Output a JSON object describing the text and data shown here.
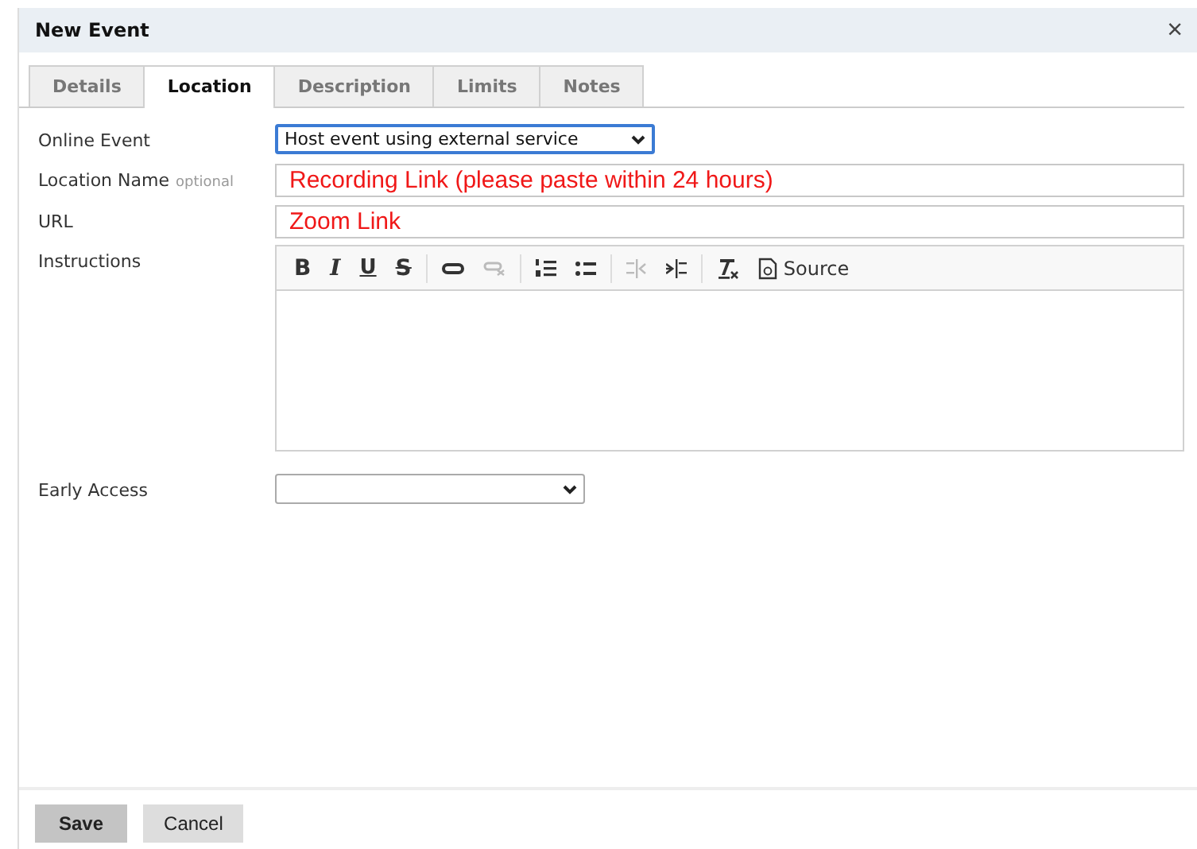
{
  "window": {
    "title": "New Event",
    "close": "×"
  },
  "tabs": [
    {
      "label": "Details",
      "selected": false
    },
    {
      "label": "Location",
      "selected": true
    },
    {
      "label": "Description",
      "selected": false
    },
    {
      "label": "Limits",
      "selected": false
    },
    {
      "label": "Notes",
      "selected": false
    }
  ],
  "fields": [
    {
      "kind": "select",
      "label": "Online Event",
      "value": "Host event using external service",
      "focused": true
    },
    {
      "kind": "text",
      "label": "Location Name",
      "hint": "optional",
      "value": "Recording Link (please paste within 24 hours)"
    },
    {
      "kind": "text",
      "label": "URL",
      "value": "Zoom Link"
    },
    {
      "kind": "editor",
      "label": "Instructions",
      "toolbar": [
        {
          "kind": "bold",
          "text": "B",
          "disabled": false
        },
        {
          "kind": "italic",
          "text": "I",
          "disabled": false
        },
        {
          "kind": "underline",
          "text": "U",
          "disabled": false
        },
        {
          "kind": "strike",
          "text": "S",
          "disabled": false
        },
        {
          "kind": "separator"
        },
        {
          "kind": "link",
          "disabled": false
        },
        {
          "kind": "unlink",
          "disabled": true
        },
        {
          "kind": "separator"
        },
        {
          "kind": "ordered-list",
          "disabled": false
        },
        {
          "kind": "bullet-list",
          "disabled": false
        },
        {
          "kind": "separator"
        },
        {
          "kind": "outdent",
          "disabled": true
        },
        {
          "kind": "indent",
          "disabled": false
        },
        {
          "kind": "separator"
        },
        {
          "kind": "remove-format",
          "disabled": false
        },
        {
          "kind": "source",
          "text": "Source",
          "disabled": false
        }
      ]
    },
    {
      "kind": "select",
      "label": "Early Access",
      "focused": false
    }
  ],
  "buttons": [
    {
      "label": "Save",
      "primary": true
    },
    {
      "label": "Cancel",
      "primary": false
    }
  ]
}
